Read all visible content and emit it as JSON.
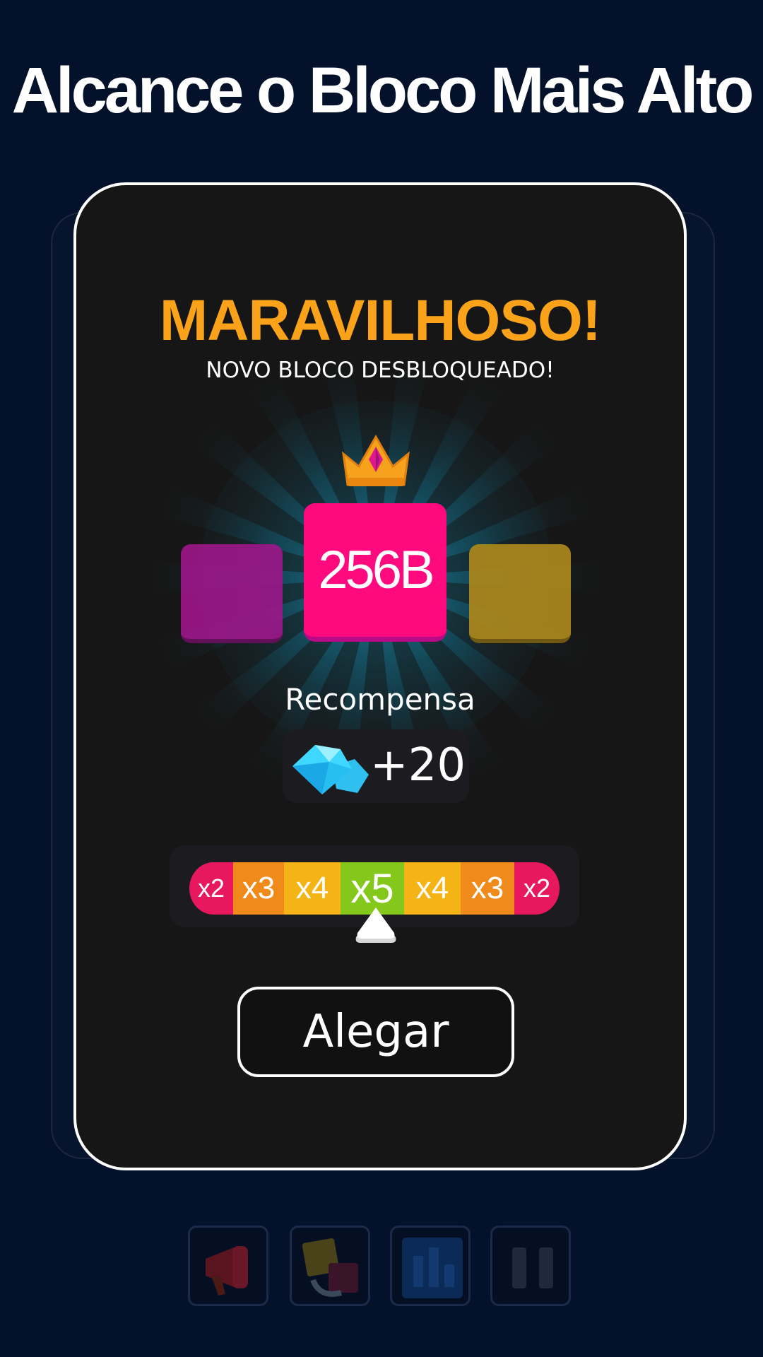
{
  "headline": "Alcance o Bloco Mais Alto",
  "dialog": {
    "title": "MARAVILHOSO!",
    "subtitle": "NOVO BLOCO DESBLOQUEADO!",
    "crown_icon": "crown-icon",
    "new_block": {
      "label": "256B",
      "color": "#ff0a7e"
    },
    "side_blocks": [
      {
        "color": "#9e178a"
      },
      {
        "color": "#b08a1c"
      }
    ],
    "reward": {
      "label": "Recompensa",
      "icon": "gem-icon",
      "amount": "+20"
    },
    "multipliers": [
      {
        "label": "x2",
        "color": "#e8185e"
      },
      {
        "label": "x3",
        "color": "#f08a1a"
      },
      {
        "label": "x4",
        "color": "#f5b416"
      },
      {
        "label": "x5",
        "color": "#84c81c",
        "selected": true
      },
      {
        "label": "x4",
        "color": "#f5b416"
      },
      {
        "label": "x3",
        "color": "#f08a1a"
      },
      {
        "label": "x2",
        "color": "#e8185e"
      }
    ],
    "claim_button": "Alegar"
  },
  "bottom_bar": [
    {
      "icon": "megaphone-icon"
    },
    {
      "icon": "swap-blocks-icon"
    },
    {
      "icon": "leaderboard-icon"
    },
    {
      "icon": "pause-icon"
    }
  ],
  "colors": {
    "background": "#04112a",
    "dialog_background": "#161616",
    "title_accent": "#f9a21a"
  }
}
